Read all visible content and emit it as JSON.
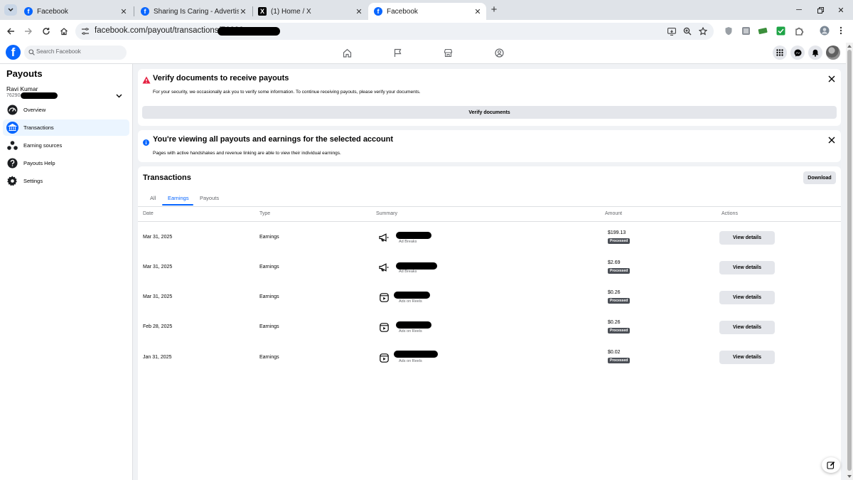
{
  "browser": {
    "tabs": [
      {
        "title": "Facebook",
        "favicon": "facebook-icon"
      },
      {
        "title": "Sharing Is Caring - Advertising",
        "favicon": "facebook-icon"
      },
      {
        "title": "(1) Home / X",
        "favicon": "x-icon"
      },
      {
        "title": "Facebook",
        "favicon": "facebook-icon",
        "active": true
      }
    ],
    "url": "facebook.com/payout/transactions/76290"
  },
  "header": {
    "logo_letter": "f",
    "search_placeholder": "Search Facebook"
  },
  "sidebar": {
    "title": "Payouts",
    "account_name": "Ravi Kumar",
    "account_id": "76290",
    "items": [
      {
        "label": "Overview",
        "icon": "speedometer-icon"
      },
      {
        "label": "Transactions",
        "icon": "bank-icon",
        "active": true
      },
      {
        "label": "Earning sources",
        "icon": "network-icon"
      },
      {
        "label": "Payouts Help",
        "icon": "help-icon"
      },
      {
        "label": "Settings",
        "icon": "gear-icon"
      }
    ]
  },
  "verify_banner": {
    "title": "Verify documents to receive payouts",
    "description": "For your security, we occasionally ask you to verify some information. To continue receiving payouts, please verify your documents.",
    "button": "Verify documents"
  },
  "info_banner": {
    "title": "You're viewing all payouts and earnings for the selected account",
    "description": "Pages with active handshakes and revenue linking are able to view their individual earnings."
  },
  "transactions": {
    "title": "Transactions",
    "download_label": "Download",
    "tabs": [
      "All",
      "Earnings",
      "Payouts"
    ],
    "active_tab": "Earnings",
    "columns": [
      "Date",
      "Type",
      "Summary",
      "Amount",
      "Actions"
    ],
    "rows": [
      {
        "date": "Mar 31, 2025",
        "type": "Earnings",
        "summary_sub": "Ad Breaks",
        "summary_icon": "megaphone-icon",
        "amount": "$199.13",
        "status": "Processed",
        "action": "View details"
      },
      {
        "date": "Mar 31, 2025",
        "type": "Earnings",
        "summary_sub": "Ad Breaks",
        "summary_icon": "megaphone-icon",
        "amount": "$2.69",
        "status": "Processed",
        "action": "View details"
      },
      {
        "date": "Mar 31, 2025",
        "type": "Earnings",
        "summary_sub": "Ads on Reels",
        "summary_icon": "reels-icon",
        "amount": "$0.26",
        "status": "Processed",
        "action": "View details"
      },
      {
        "date": "Feb 28, 2025",
        "type": "Earnings",
        "summary_sub": "Ads on Reels",
        "summary_icon": "reels-icon",
        "amount": "$0.26",
        "status": "Processed",
        "action": "View details"
      },
      {
        "date": "Jan 31, 2025",
        "type": "Earnings",
        "summary_sub": "Ads on Reels",
        "summary_icon": "reels-icon",
        "amount": "$0.02",
        "status": "Processed",
        "action": "View details"
      }
    ]
  },
  "colors": {
    "brand": "#0866ff",
    "warning": "#e41e3f",
    "badge": "#4b4f56"
  }
}
